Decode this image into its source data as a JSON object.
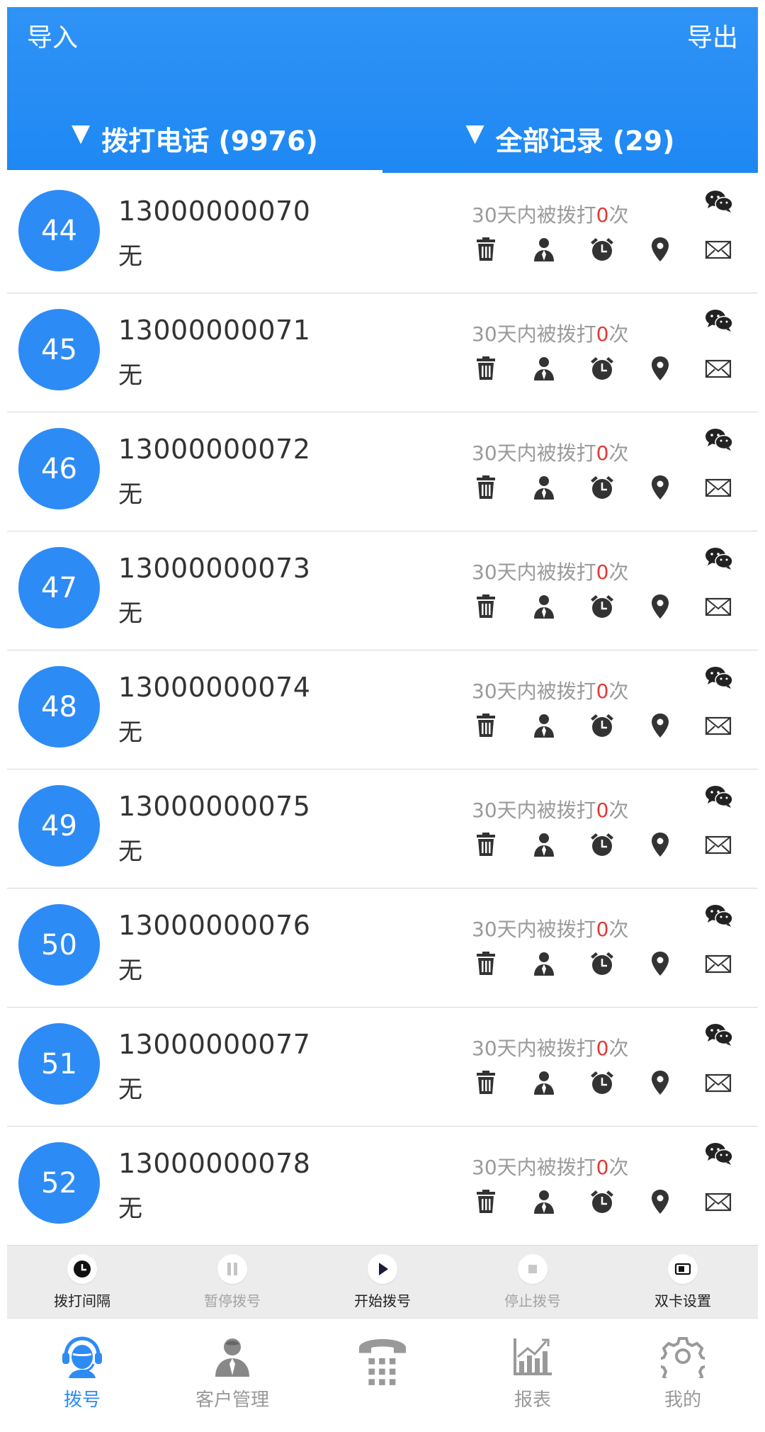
{
  "header": {
    "import_label": "导入",
    "export_label": "导出",
    "tabs": [
      {
        "label": "拨打电话 (9976)",
        "arrow": "▼"
      },
      {
        "label": "全部记录 (29)",
        "arrow": "▼"
      }
    ]
  },
  "contacts": [
    {
      "index": "44",
      "phone": "13000000070",
      "note": "无",
      "calls_prefix": "30天内被拨打",
      "calls_count": "0",
      "calls_suffix": "次"
    },
    {
      "index": "45",
      "phone": "13000000071",
      "note": "无",
      "calls_prefix": "30天内被拨打",
      "calls_count": "0",
      "calls_suffix": "次"
    },
    {
      "index": "46",
      "phone": "13000000072",
      "note": "无",
      "calls_prefix": "30天内被拨打",
      "calls_count": "0",
      "calls_suffix": "次"
    },
    {
      "index": "47",
      "phone": "13000000073",
      "note": "无",
      "calls_prefix": "30天内被拨打",
      "calls_count": "0",
      "calls_suffix": "次"
    },
    {
      "index": "48",
      "phone": "13000000074",
      "note": "无",
      "calls_prefix": "30天内被拨打",
      "calls_count": "0",
      "calls_suffix": "次"
    },
    {
      "index": "49",
      "phone": "13000000075",
      "note": "无",
      "calls_prefix": "30天内被拨打",
      "calls_count": "0",
      "calls_suffix": "次"
    },
    {
      "index": "50",
      "phone": "13000000076",
      "note": "无",
      "calls_prefix": "30天内被拨打",
      "calls_count": "0",
      "calls_suffix": "次"
    },
    {
      "index": "51",
      "phone": "13000000077",
      "note": "无",
      "calls_prefix": "30天内被拨打",
      "calls_count": "0",
      "calls_suffix": "次"
    },
    {
      "index": "52",
      "phone": "13000000078",
      "note": "无",
      "calls_prefix": "30天内被拨打",
      "calls_count": "0",
      "calls_suffix": "次"
    }
  ],
  "row_actions": [
    "trash-icon",
    "contact-icon",
    "alarm-clock-icon",
    "location-pin-icon",
    "mail-icon"
  ],
  "controls": [
    {
      "label": "拨打间隔",
      "icon": "clock-icon",
      "enabled": true
    },
    {
      "label": "暂停拨号",
      "icon": "pause-icon",
      "enabled": false
    },
    {
      "label": "开始拨号",
      "icon": "play-icon",
      "enabled": true
    },
    {
      "label": "停止拨号",
      "icon": "stop-icon",
      "enabled": false
    },
    {
      "label": "双卡设置",
      "icon": "sim-card-icon",
      "enabled": true
    }
  ],
  "nav": [
    {
      "label": "拨号",
      "icon": "headset-agent-icon",
      "active": true
    },
    {
      "label": "客户管理",
      "icon": "person-icon",
      "active": false
    },
    {
      "label": "",
      "icon": "desk-phone-icon",
      "active": false
    },
    {
      "label": "报表",
      "icon": "chart-icon",
      "active": false
    },
    {
      "label": "我的",
      "icon": "gear-icon",
      "active": false
    }
  ],
  "colors": {
    "header_blue": "#1e88f3",
    "badge_blue": "#2d8bf5",
    "count_red": "#e53935",
    "muted_gray": "#9a9a9a"
  }
}
